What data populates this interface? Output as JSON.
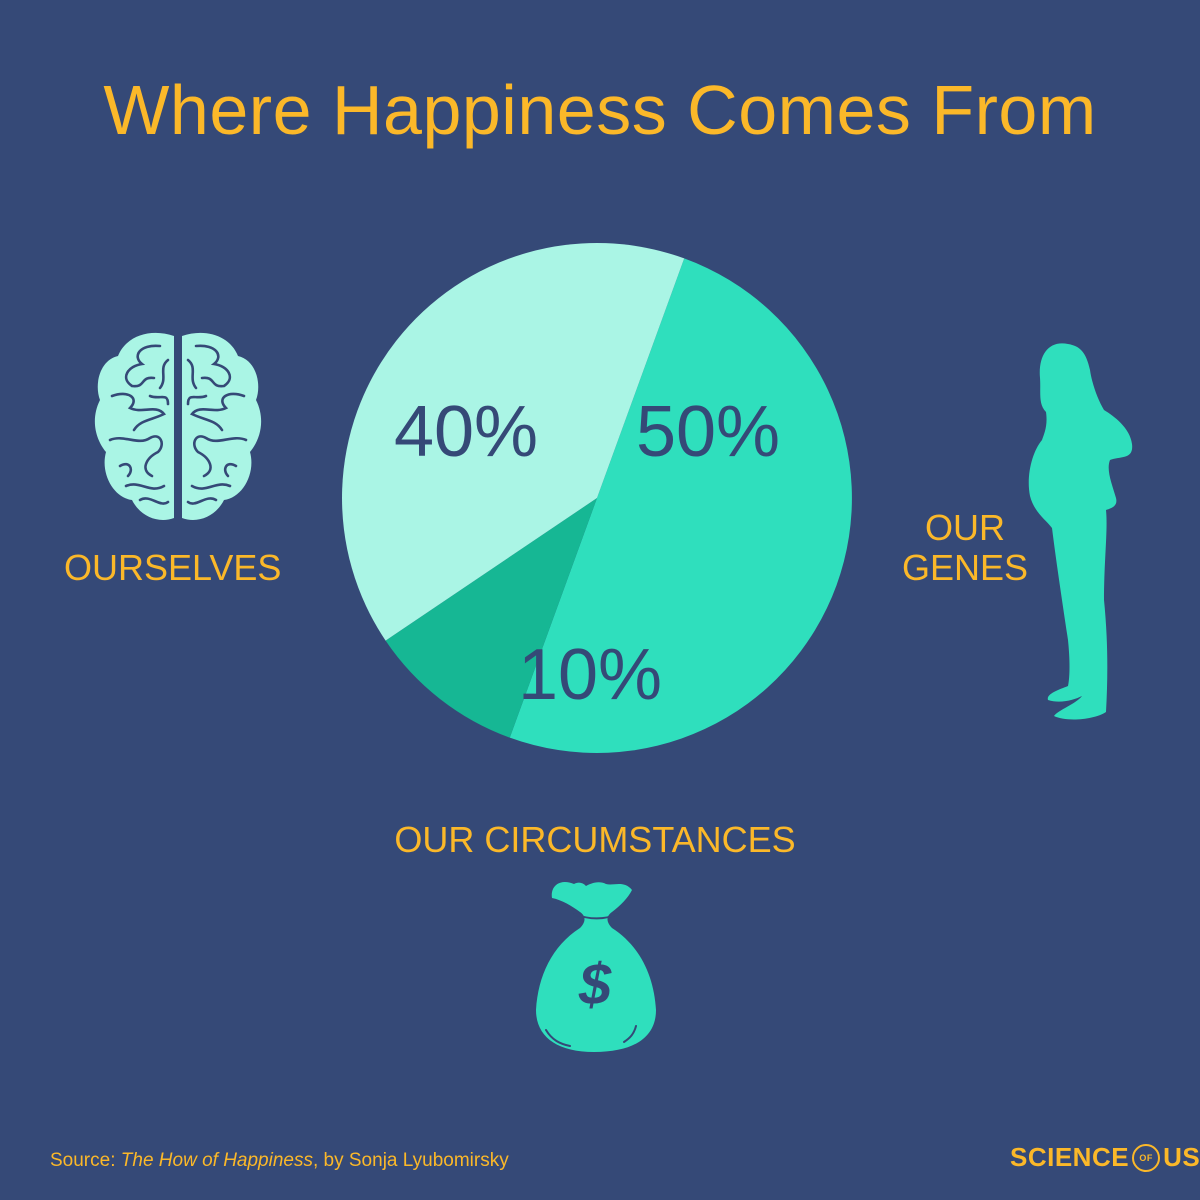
{
  "title": "Where Happiness Comes From",
  "colors": {
    "background": "#354977",
    "accent": "#fbb829",
    "slice_ourselves": "#aaf5e5",
    "slice_genes": "#2fdfbd",
    "slice_circumstances": "#16b794",
    "percent_text": "#354977",
    "icon_brain": "#aaf5e5",
    "icon_teal": "#2fdfbd"
  },
  "labels": {
    "ourselves": "OURSELVES",
    "genes_line1": "OUR",
    "genes_line2": "GENES",
    "circumstances": "OUR CIRCUMSTANCES"
  },
  "icons": {
    "brain": "brain-icon",
    "person": "pregnant-woman-silhouette-icon",
    "money": "money-bag-icon",
    "money_symbol": "$"
  },
  "source": {
    "prefix": "Source: ",
    "book": "The How of Happiness",
    "suffix": ", by Sonja Lyubomirsky"
  },
  "logo": {
    "left": "SCIENCE",
    "middle": "OF",
    "right": "US"
  },
  "chart_data": {
    "type": "pie",
    "title": "Where Happiness Comes From",
    "slices": [
      {
        "name": "OUR GENES",
        "value": 50,
        "label": "50%"
      },
      {
        "name": "OUR CIRCUMSTANCES",
        "value": 10,
        "label": "10%"
      },
      {
        "name": "OURSELVES",
        "value": 40,
        "label": "40%"
      }
    ],
    "start_angle_deg": 20
  }
}
